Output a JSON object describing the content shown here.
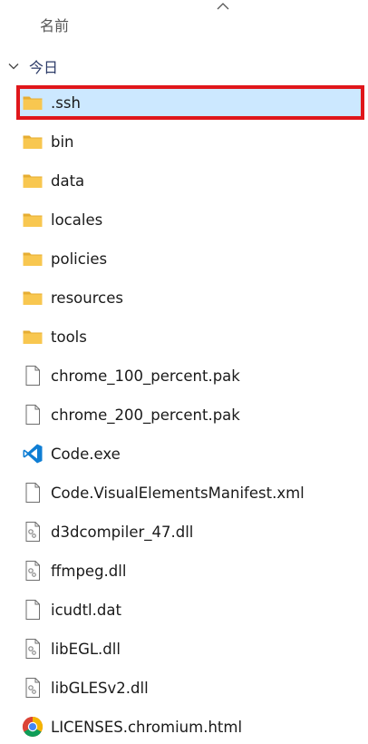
{
  "header": {
    "name_column": "名前"
  },
  "group": {
    "label": "今日"
  },
  "files": [
    {
      "name": ".ssh",
      "icon": "folder-icon",
      "selected": true
    },
    {
      "name": "bin",
      "icon": "folder-icon"
    },
    {
      "name": "data",
      "icon": "folder-icon"
    },
    {
      "name": "locales",
      "icon": "folder-icon"
    },
    {
      "name": "policies",
      "icon": "folder-icon"
    },
    {
      "name": "resources",
      "icon": "folder-icon"
    },
    {
      "name": "tools",
      "icon": "folder-icon"
    },
    {
      "name": "chrome_100_percent.pak",
      "icon": "file-icon"
    },
    {
      "name": "chrome_200_percent.pak",
      "icon": "file-icon"
    },
    {
      "name": "Code.exe",
      "icon": "vscode-icon"
    },
    {
      "name": "Code.VisualElementsManifest.xml",
      "icon": "file-icon"
    },
    {
      "name": "d3dcompiler_47.dll",
      "icon": "dll-icon"
    },
    {
      "name": "ffmpeg.dll",
      "icon": "dll-icon"
    },
    {
      "name": "icudtl.dat",
      "icon": "file-icon"
    },
    {
      "name": "libEGL.dll",
      "icon": "dll-icon"
    },
    {
      "name": "libGLESv2.dll",
      "icon": "dll-icon"
    },
    {
      "name": "LICENSES.chromium.html",
      "icon": "chrome-icon"
    }
  ],
  "colors": {
    "selection_background": "#cce8ff",
    "highlight_border": "#e0161b",
    "folder": "#f8c750"
  }
}
